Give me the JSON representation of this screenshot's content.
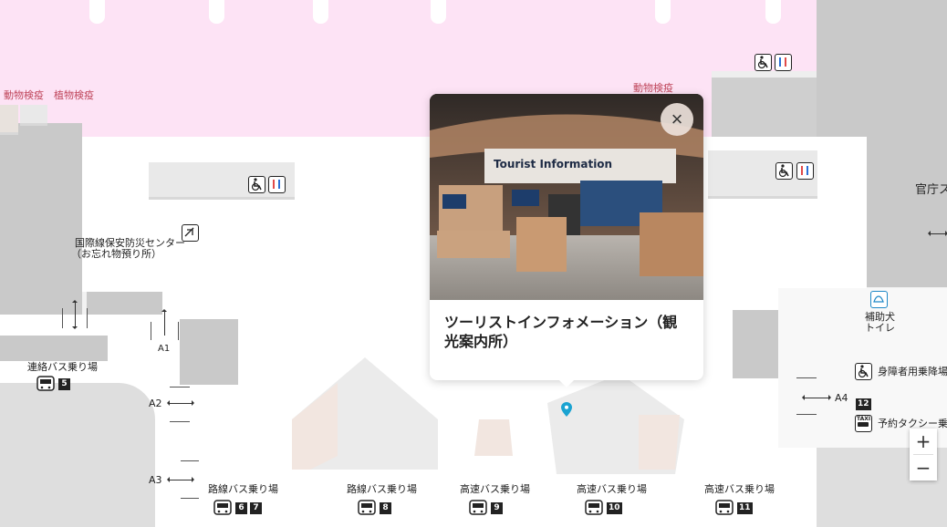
{
  "map": {
    "labels": {
      "animal_quarantine_left": "動物検疫",
      "plant_quarantine": "植物検疫",
      "animal_quarantine_right": "動物検疫",
      "govt_office": "官庁ス",
      "security_center_line1": "国際線保安防災センター",
      "security_center_line2": "（お忘れ物預り所）",
      "service_dog_line1": "補助犬",
      "service_dog_line2": "トイレ",
      "disabled_boarding": "身障者用乗降場",
      "reserved_taxi": "予約タクシー乗り場",
      "taxi_icon_text": "TAXI",
      "shuttle_bus": "連絡バス乗り場",
      "route_bus_1": "路線バス乗り場",
      "route_bus_2": "路線バス乗り場",
      "express_bus_1": "高速バス乗り場",
      "express_bus_2": "高速バス乗り場",
      "express_bus_3": "高速バス乗り場"
    },
    "gates": {
      "a1": "A1",
      "a2": "A2",
      "a3": "A3",
      "a4": "A4"
    },
    "stop_numbers": {
      "shuttle": "5",
      "route_a": "6",
      "route_b": "7",
      "route_c": "8",
      "express_a": "9",
      "express_b": "10",
      "express_c": "11",
      "a4_stop": "12"
    },
    "colors": {
      "arrival_zone": "#fde3f5",
      "building_block": "#c9c9c9",
      "quarantine_text": "#c0475c",
      "marker": "#1aa3d1"
    }
  },
  "popup": {
    "title": "ツーリストインフォメーション（観光案内所）",
    "photo_sign_text": "Tourist Information",
    "close_label": "×"
  },
  "zoom": {
    "in_label": "+",
    "out_label": "−"
  }
}
